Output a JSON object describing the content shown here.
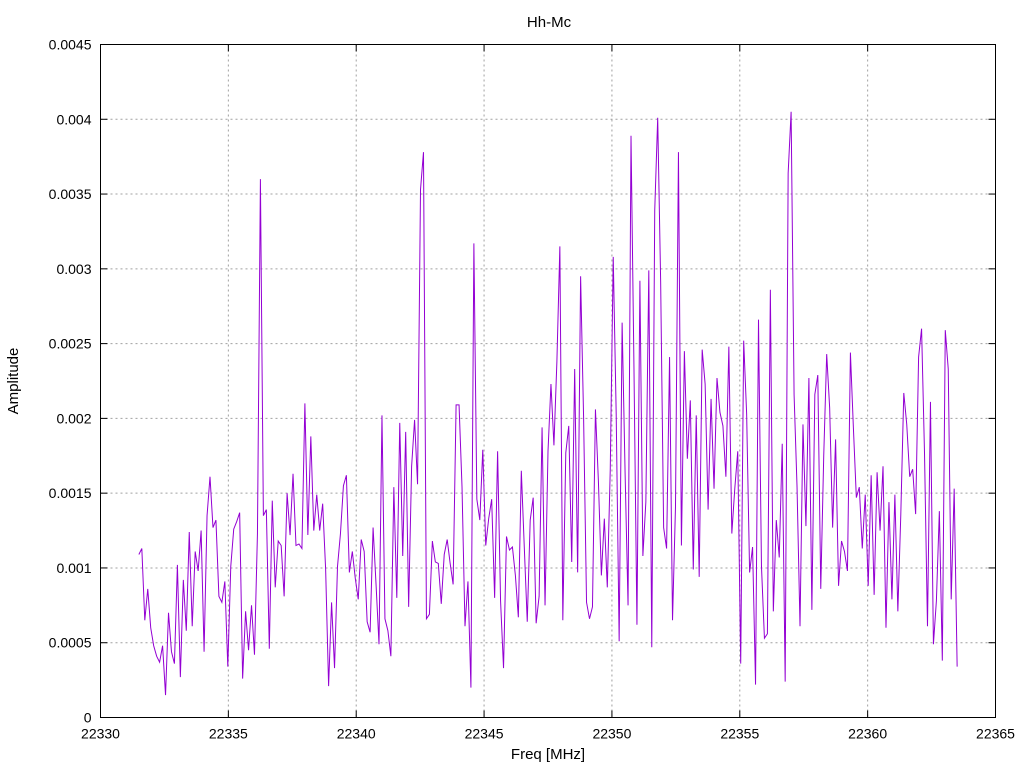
{
  "chart_data": {
    "type": "line",
    "title": "Hh-Mc",
    "xlabel": "Freq [MHz]",
    "ylabel": "Amplitude",
    "xlim": [
      22330,
      22365
    ],
    "ylim": [
      0,
      0.0045
    ],
    "x_ticks": [
      "22330",
      "22335",
      "22340",
      "22345",
      "22350",
      "22355",
      "22360",
      "22365"
    ],
    "y_ticks": [
      "0",
      "0.0005",
      "0.001",
      "0.0015",
      "0.002",
      "0.0025",
      "0.003",
      "0.0035",
      "0.004",
      "0.0045"
    ],
    "grid": true,
    "line_color": "#9400d3",
    "series": [
      {
        "x_start": 22331.5,
        "x_end": 22363.5,
        "values": [
          0.00109,
          0.00113,
          0.00065,
          0.00086,
          0.0006,
          0.00048,
          0.00041,
          0.00037,
          0.00048,
          0.00015,
          0.0007,
          0.00044,
          0.00036,
          0.00102,
          0.00027,
          0.00092,
          0.00058,
          0.00124,
          0.00061,
          0.00111,
          0.00098,
          0.00125,
          0.00044,
          0.00135,
          0.00161,
          0.00127,
          0.00132,
          0.00081,
          0.00077,
          0.00091,
          0.00034,
          0.00101,
          0.00126,
          0.00131,
          0.00137,
          0.00026,
          0.00071,
          0.00045,
          0.00075,
          0.00042,
          0.00123,
          0.0036,
          0.00135,
          0.00139,
          0.00046,
          0.00145,
          0.00087,
          0.00118,
          0.00115,
          0.00081,
          0.0015,
          0.00122,
          0.00163,
          0.00115,
          0.00116,
          0.00113,
          0.0021,
          0.00122,
          0.00188,
          0.00125,
          0.00149,
          0.00125,
          0.00143,
          0.00099,
          0.00021,
          0.00077,
          0.00033,
          0.00101,
          0.00123,
          0.00155,
          0.00162,
          0.00097,
          0.00111,
          0.00093,
          0.00079,
          0.00119,
          0.00111,
          0.00064,
          0.00057,
          0.00127,
          0.00089,
          0.00049,
          0.00202,
          0.00066,
          0.00058,
          0.00041,
          0.00154,
          0.0008,
          0.00197,
          0.00108,
          0.00191,
          0.00074,
          0.00168,
          0.00199,
          0.00156,
          0.00353,
          0.00378,
          0.00066,
          0.00069,
          0.00118,
          0.00104,
          0.00103,
          0.00076,
          0.00109,
          0.00119,
          0.00103,
          0.00089,
          0.00209,
          0.00209,
          0.00154,
          0.00061,
          0.00091,
          0.0002,
          0.00317,
          0.00146,
          0.00132,
          0.00179,
          0.00115,
          0.00133,
          0.00146,
          0.0008,
          0.00178,
          0.00078,
          0.00033,
          0.00121,
          0.00112,
          0.00114,
          0.00095,
          0.00067,
          0.00165,
          0.00114,
          0.00064,
          0.00132,
          0.00147,
          0.00063,
          0.00081,
          0.00194,
          0.00075,
          0.00178,
          0.00223,
          0.00182,
          0.00238,
          0.00315,
          0.00065,
          0.00177,
          0.00195,
          0.00104,
          0.00233,
          0.00097,
          0.00295,
          0.00201,
          0.00077,
          0.00066,
          0.00074,
          0.00206,
          0.00158,
          0.00095,
          0.00133,
          0.00087,
          0.00166,
          0.00308,
          0.00203,
          0.00051,
          0.00264,
          0.00164,
          0.00075,
          0.00389,
          0.00233,
          0.00062,
          0.00292,
          0.00108,
          0.00144,
          0.00299,
          0.00047,
          0.00339,
          0.00401,
          0.00291,
          0.00127,
          0.00113,
          0.00241,
          0.00065,
          0.00141,
          0.00378,
          0.00115,
          0.00245,
          0.00173,
          0.00212,
          0.00099,
          0.00202,
          0.00094,
          0.00246,
          0.00223,
          0.00139,
          0.00213,
          0.00153,
          0.00227,
          0.00204,
          0.00195,
          0.00161,
          0.00248,
          0.00123,
          0.00153,
          0.00178,
          0.00036,
          0.00252,
          0.00203,
          0.00097,
          0.00114,
          0.00022,
          0.00266,
          0.00101,
          0.00053,
          0.00056,
          0.00286,
          0.00071,
          0.00132,
          0.00107,
          0.00183,
          0.00024,
          0.00364,
          0.00405,
          0.00216,
          0.00154,
          0.00061,
          0.00196,
          0.00128,
          0.00227,
          0.00072,
          0.00216,
          0.00229,
          0.00086,
          0.00175,
          0.00243,
          0.00207,
          0.00127,
          0.00186,
          0.00088,
          0.00118,
          0.00111,
          0.00098,
          0.00244,
          0.00194,
          0.00147,
          0.00154,
          0.00113,
          0.00149,
          0.00088,
          0.00162,
          0.00082,
          0.00164,
          0.00125,
          0.00168,
          0.0006,
          0.00144,
          0.00079,
          0.00149,
          0.00071,
          0.00136,
          0.00217,
          0.00196,
          0.00161,
          0.00166,
          0.00136,
          0.00241,
          0.0026,
          0.00176,
          0.00061,
          0.00211,
          0.00049,
          0.00078,
          0.00138,
          0.00038,
          0.00259,
          0.00233,
          0.00079,
          0.00153,
          0.00034
        ]
      }
    ]
  }
}
